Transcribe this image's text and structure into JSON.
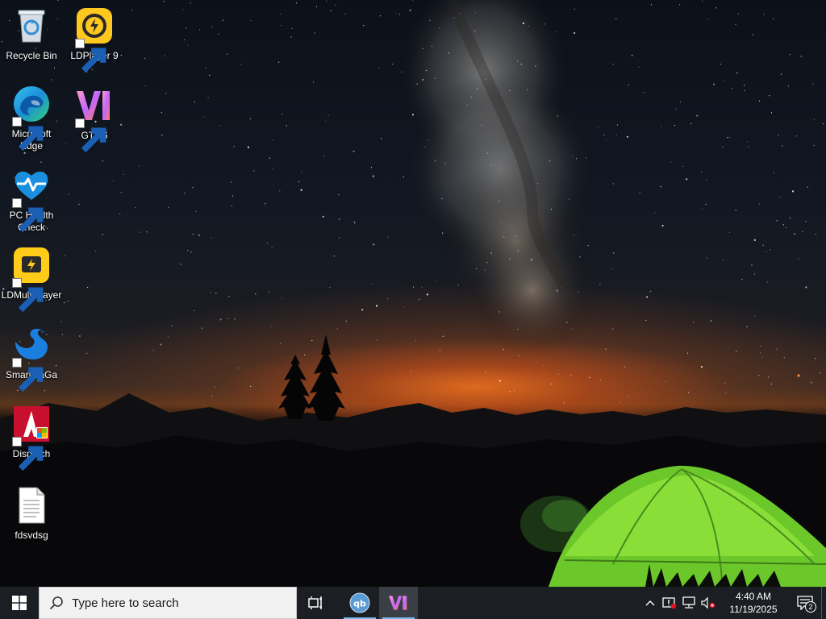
{
  "desktop": {
    "icons": [
      {
        "label": "Recycle Bin"
      },
      {
        "label": "LDPlayer 9"
      },
      {
        "label": "Microsoft Edge"
      },
      {
        "label": "GTA 6"
      },
      {
        "label": "PC Health Check"
      },
      {
        "label": "LDMultiPlayer"
      },
      {
        "label": "SmartGaGa"
      },
      {
        "label": "Dispatch"
      },
      {
        "label": "fdsvdsg"
      }
    ]
  },
  "taskbar": {
    "search_placeholder": "Type here to search",
    "pinned": [
      "task-view-icon",
      "qbittorrent-icon",
      "gta6-icon"
    ],
    "clock": {
      "time": "4:40 AM",
      "date": "11/19/2025"
    },
    "notification_count": "2"
  },
  "colors": {
    "taskbar_bg": "#1b1e22",
    "accent": "#76b9ed",
    "tent": "#7bd62b"
  }
}
